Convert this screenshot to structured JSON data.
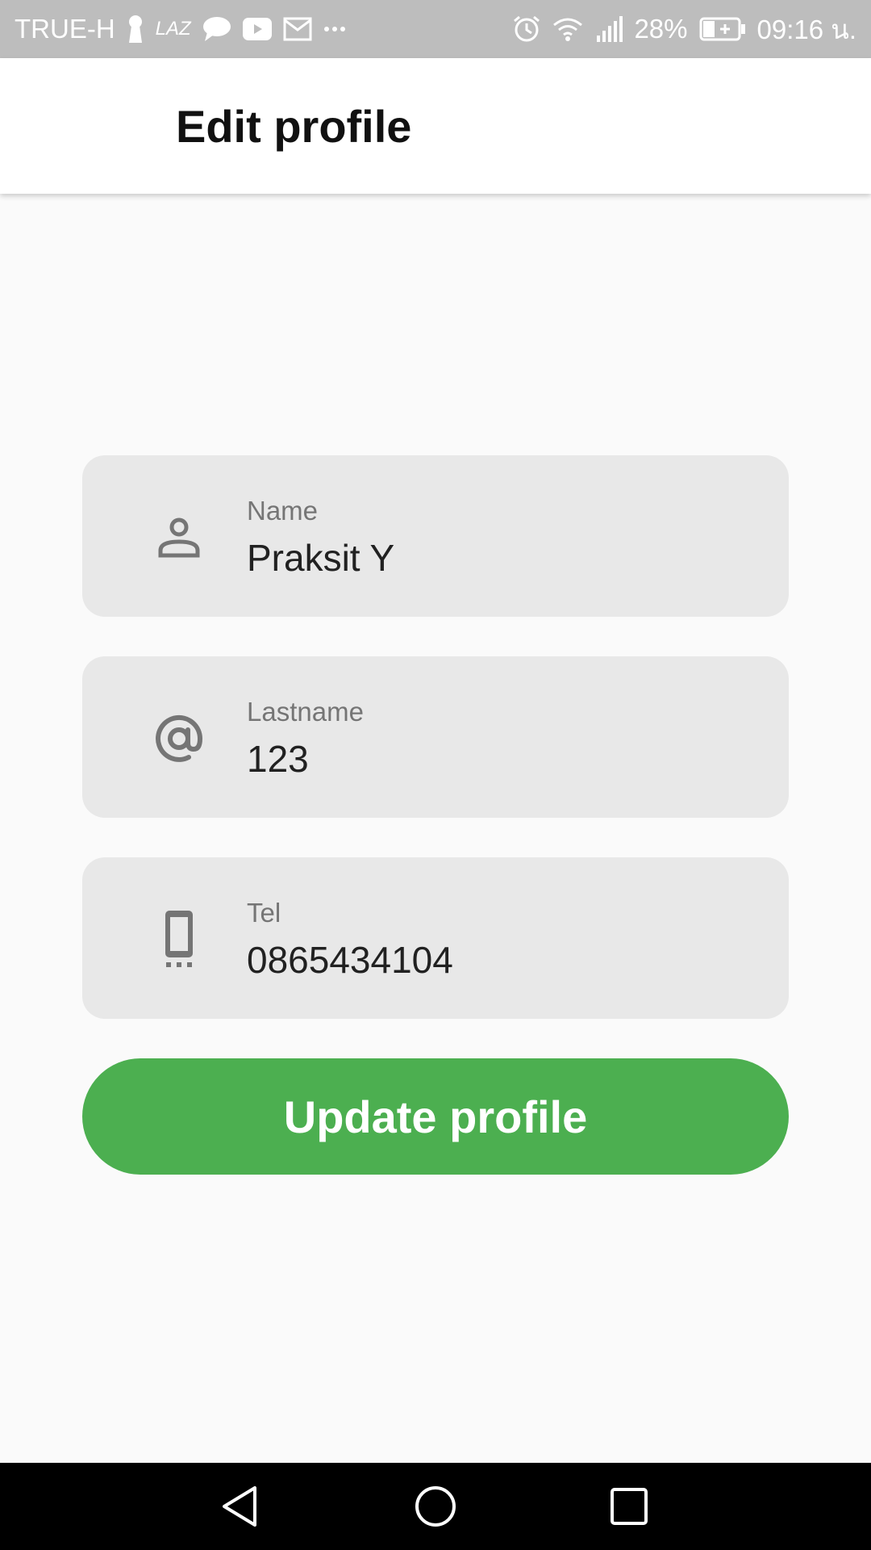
{
  "status_bar": {
    "carrier": "TRUE-H",
    "app_badge": "LAZ",
    "battery_percent": "28%",
    "time": "09:16 น.",
    "icons": [
      "keyhole-icon",
      "laz-icon",
      "chat-bubble-icon",
      "youtube-icon",
      "mail-icon",
      "more-dots-icon",
      "alarm-icon",
      "wifi-icon",
      "signal-icon",
      "battery-charging-icon"
    ]
  },
  "app_bar": {
    "title": "Edit profile"
  },
  "form": {
    "fields": [
      {
        "label": "Name",
        "value": "Praksit Y",
        "icon": "person-icon"
      },
      {
        "label": "Lastname",
        "value": "123",
        "icon": "at-sign-icon"
      },
      {
        "label": "Tel",
        "value": "0865434104",
        "icon": "smartphone-icon"
      }
    ]
  },
  "actions": {
    "update_label": "Update profile"
  },
  "nav_bar": {
    "icons": [
      "back-triangle-icon",
      "home-circle-icon",
      "recents-square-icon"
    ]
  },
  "colors": {
    "status_bar_bg": "#bdbdbd",
    "app_bar_bg": "#ffffff",
    "page_bg": "#fafafa",
    "field_bg": "#e8e8e8",
    "button_bg": "#4caf50",
    "button_text": "#ffffff",
    "nav_bar_bg": "#000000"
  }
}
